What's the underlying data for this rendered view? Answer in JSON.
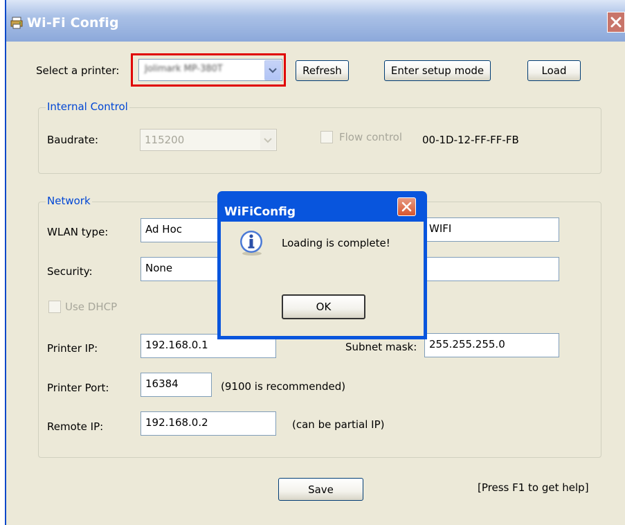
{
  "window": {
    "title": "Wi-Fi Config",
    "close_icon": "close-icon",
    "app_icon": "printer-network-icon"
  },
  "top_bar": {
    "printer_label": "Select a printer:",
    "printer_value": "Jolimark MP-380T",
    "refresh_label": "Refresh",
    "setup_label": "Enter setup mode",
    "load_label": "Load"
  },
  "internal_control": {
    "title": "Internal Control",
    "baudrate_label": "Baudrate:",
    "baudrate_value": "115200",
    "flow_control_label": "Flow control",
    "mac_address": "00-1D-12-FF-FF-FB"
  },
  "network": {
    "title": "Network",
    "wlan_type_label": "WLAN type:",
    "wlan_type_value": "Ad Hoc",
    "ssid_value": "WIFI",
    "security_label": "Security:",
    "security_value": "None",
    "key_value": "",
    "use_dhcp_label": "Use DHCP",
    "printer_ip_label": "Printer IP:",
    "printer_ip_value": "192.168.0.1",
    "subnet_mask_label": "Subnet mask:",
    "subnet_mask_value": "255.255.255.0",
    "printer_port_label": "Printer Port:",
    "printer_port_value": "16384",
    "port_hint": "(9100 is recommended)",
    "remote_ip_label": "Remote IP:",
    "remote_ip_value": "192.168.0.2",
    "remote_ip_hint": "(can be partial IP)"
  },
  "footer": {
    "save_label": "Save",
    "help_text": "[Press F1 to get help]"
  },
  "dialog": {
    "title": "WiFiConfig",
    "message": "Loading is complete!",
    "ok_label": "OK",
    "icon": "info-icon"
  },
  "colors": {
    "window_bg": "#ECE9D8",
    "group_title": "#0046D5",
    "dialog_frame": "#0855DD",
    "highlight_box": "#E00000"
  }
}
